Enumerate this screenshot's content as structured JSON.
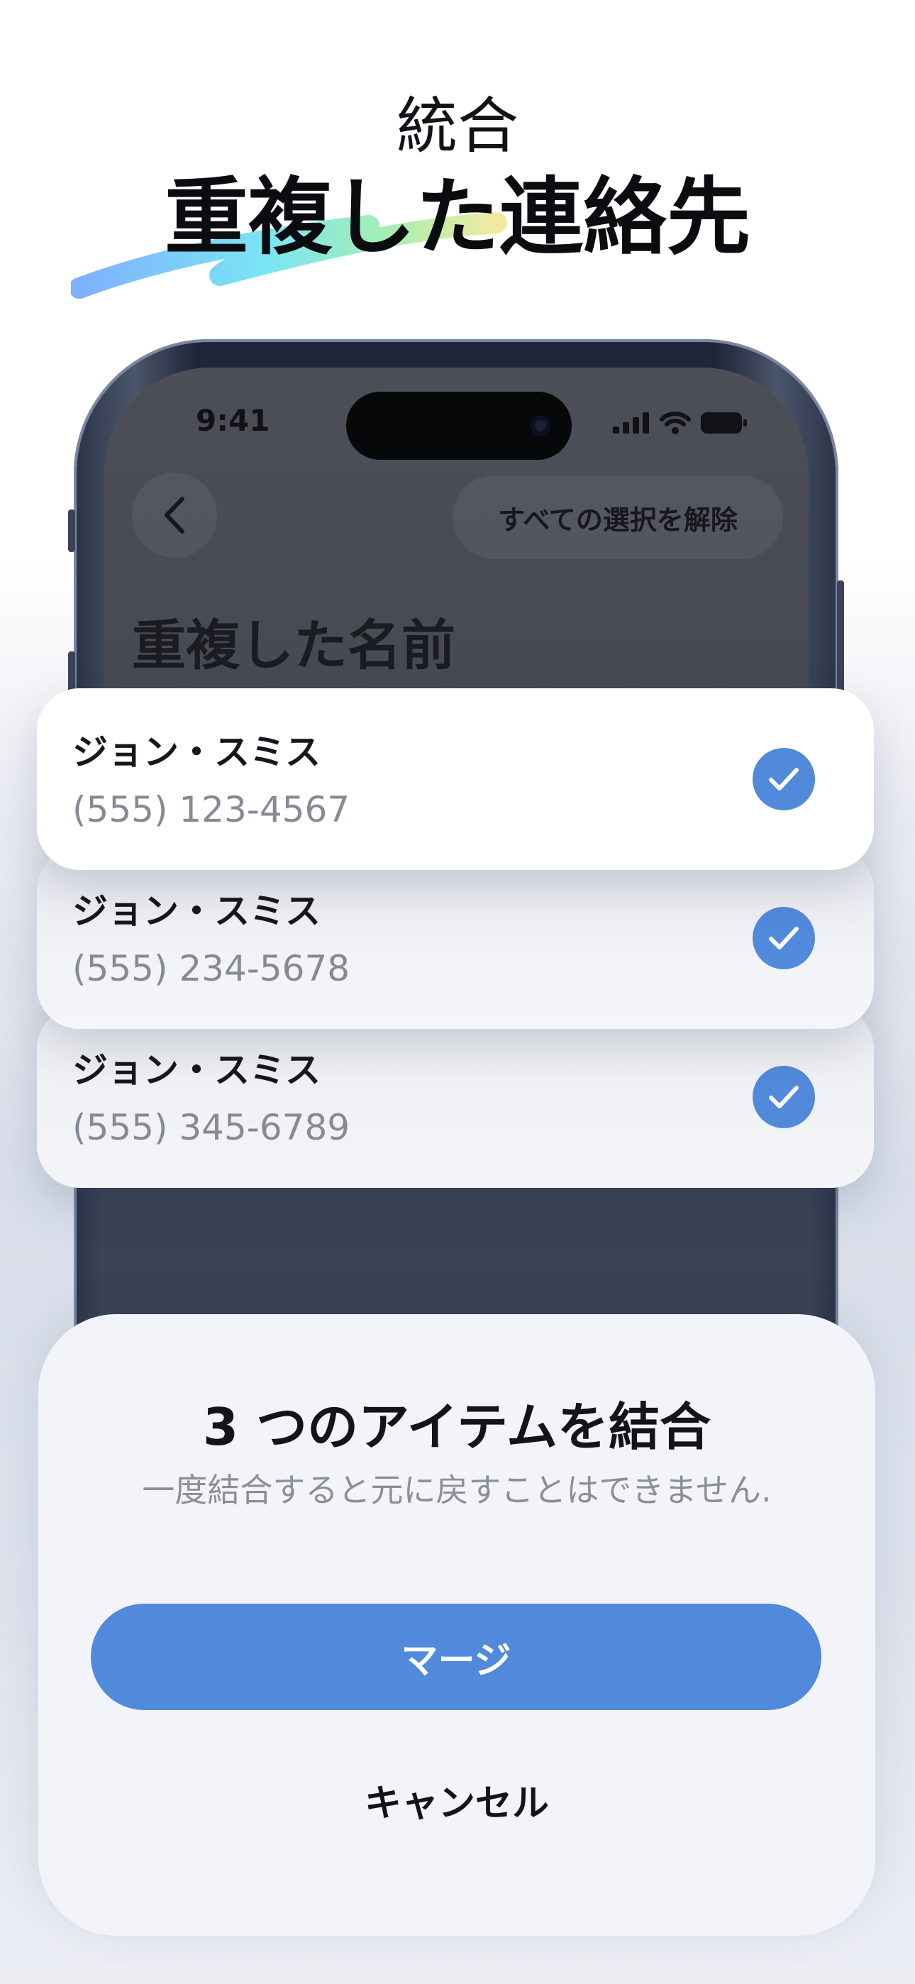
{
  "headline": {
    "eyebrow": "統合",
    "title": "重複した連絡先"
  },
  "phone": {
    "status_time": "9:41",
    "deselect_all_label": "すべての選択を解除",
    "screen_title": "重複した名前"
  },
  "contacts": [
    {
      "name": "ジョン・スミス",
      "phone": "(555) 123-4567",
      "selected": true
    },
    {
      "name": "ジョン・スミス",
      "phone": "(555) 234-5678",
      "selected": true
    },
    {
      "name": "ジョン・スミス",
      "phone": "(555) 345-6789",
      "selected": true
    }
  ],
  "sheet": {
    "title": "3 つのアイテムを結合",
    "subtitle": "一度結合すると元に戻すことはできません.",
    "merge_label": "マージ",
    "cancel_label": "キャンセル"
  },
  "colors": {
    "accent": "#5189db",
    "title_text": "#0b0c10",
    "secondary_text": "#868a95"
  },
  "icons": [
    "back-chevron-icon",
    "signal-icon",
    "wifi-icon",
    "battery-icon",
    "checkmark-icon"
  ]
}
